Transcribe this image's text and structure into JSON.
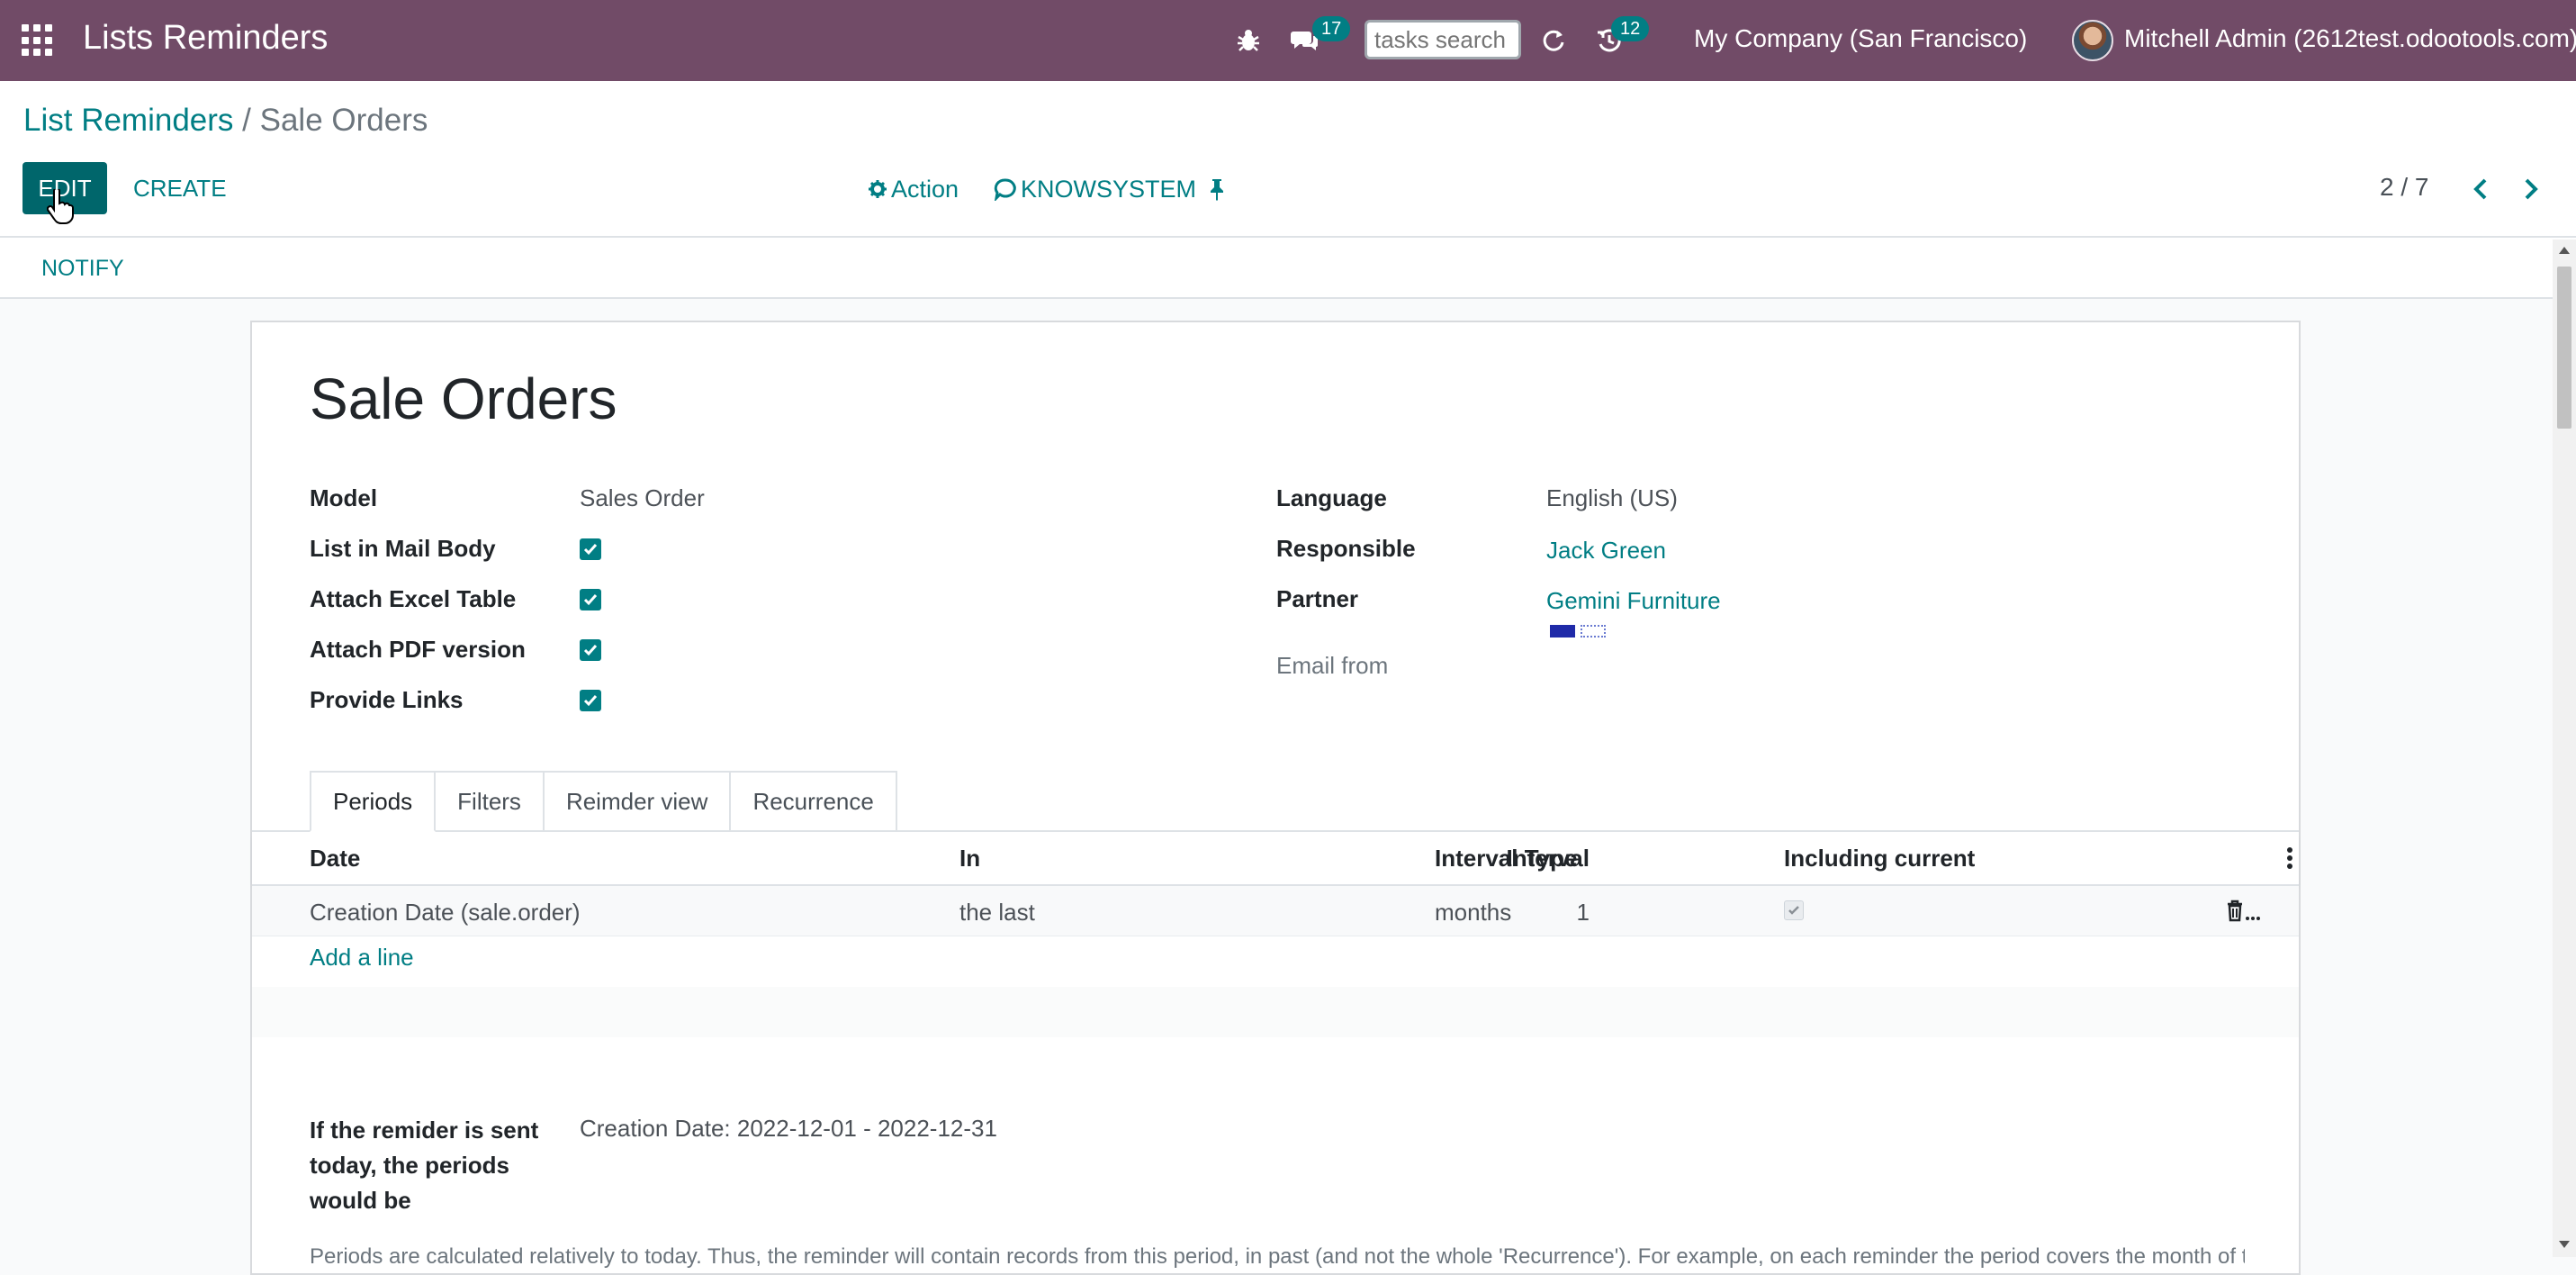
{
  "navbar": {
    "app_title": "Lists Reminders",
    "messages_count": "17",
    "activities_count": "12",
    "search_placeholder": "tasks search",
    "company": "My Company (San Francisco)",
    "user": "Mitchell Admin (2612test.odootools.com)"
  },
  "breadcrumb": {
    "parent": "List Reminders",
    "separator": "/",
    "current": "Sale Orders"
  },
  "control_panel": {
    "edit_label": "EDIT",
    "create_label": "CREATE",
    "action_label": "Action",
    "knowsystem_label": "KNOWSYSTEM",
    "pager": "2 / 7"
  },
  "statusbar": {
    "notify_label": "NOTIFY"
  },
  "record": {
    "title": "Sale Orders",
    "left_fields": [
      {
        "label": "Model",
        "value": "Sales Order"
      },
      {
        "label": "List in Mail Body",
        "checked": true
      },
      {
        "label": "Attach Excel Table",
        "checked": true
      },
      {
        "label": "Attach PDF version",
        "checked": true
      },
      {
        "label": "Provide Links",
        "checked": true
      }
    ],
    "right_fields": [
      {
        "label": "Language",
        "value": "English (US)"
      },
      {
        "label": "Responsible",
        "value": "Jack Green"
      },
      {
        "label": "Partner",
        "value": "Gemini Furniture"
      },
      {
        "label": "Email from",
        "value": ""
      }
    ]
  },
  "tabs": [
    "Periods",
    "Filters",
    "Reimder view",
    "Recurrence"
  ],
  "table": {
    "columns": [
      "Date",
      "In",
      "Interval",
      "Interval Type",
      "Including current"
    ],
    "rows": [
      {
        "date": "Creation Date (sale.order)",
        "in": "the last",
        "interval": "1",
        "interval_type": "months",
        "including_current": true
      }
    ],
    "add_line": "Add a line"
  },
  "periods_summary": {
    "label": "If the remider is sent today, the periods would be",
    "value": "Creation Date: 2022-12-01 - 2022-12-31"
  },
  "help_text": "Periods are calculated relatively to today. Thus, the reminder will contain records from this period, in past (and not the whole 'Recurrence'). For example, on each reminder the period covers the month of the first",
  "colors": {
    "navbar": "#714b67",
    "primary": "#00666b",
    "link": "#017e84"
  }
}
